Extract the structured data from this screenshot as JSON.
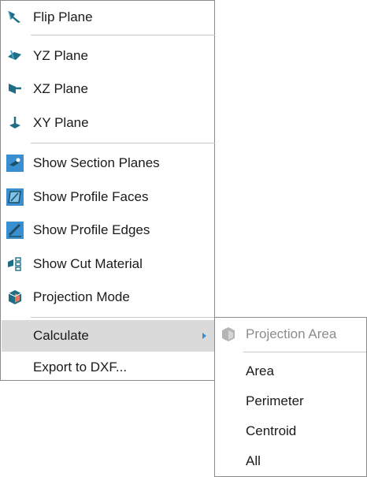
{
  "menu": {
    "items": [
      {
        "label": "Flip Plane",
        "icon": "flip-plane-icon"
      },
      {
        "label": "YZ Plane",
        "icon": "yz-plane-icon"
      },
      {
        "label": "XZ Plane",
        "icon": "xz-plane-icon"
      },
      {
        "label": "XY Plane",
        "icon": "xy-plane-icon"
      },
      {
        "label": "Show Section Planes",
        "icon": "section-planes-icon"
      },
      {
        "label": "Show Profile Faces",
        "icon": "profile-faces-icon"
      },
      {
        "label": "Show Profile Edges",
        "icon": "profile-edges-icon"
      },
      {
        "label": "Show Cut Material",
        "icon": "cut-material-icon"
      },
      {
        "label": "Projection Mode",
        "icon": "projection-mode-icon"
      },
      {
        "label": "Calculate",
        "icon": ""
      },
      {
        "label": "Export to DXF...",
        "icon": ""
      }
    ]
  },
  "submenu": {
    "items": [
      {
        "label": "Projection Area",
        "icon": "projection-area-icon",
        "disabled": true
      },
      {
        "label": "Area"
      },
      {
        "label": "Perimeter"
      },
      {
        "label": "Centroid"
      },
      {
        "label": "All"
      }
    ]
  },
  "colors": {
    "accent": "#3a8fd0",
    "icon_teal": "#1e6f86",
    "highlight": "#dadada"
  }
}
